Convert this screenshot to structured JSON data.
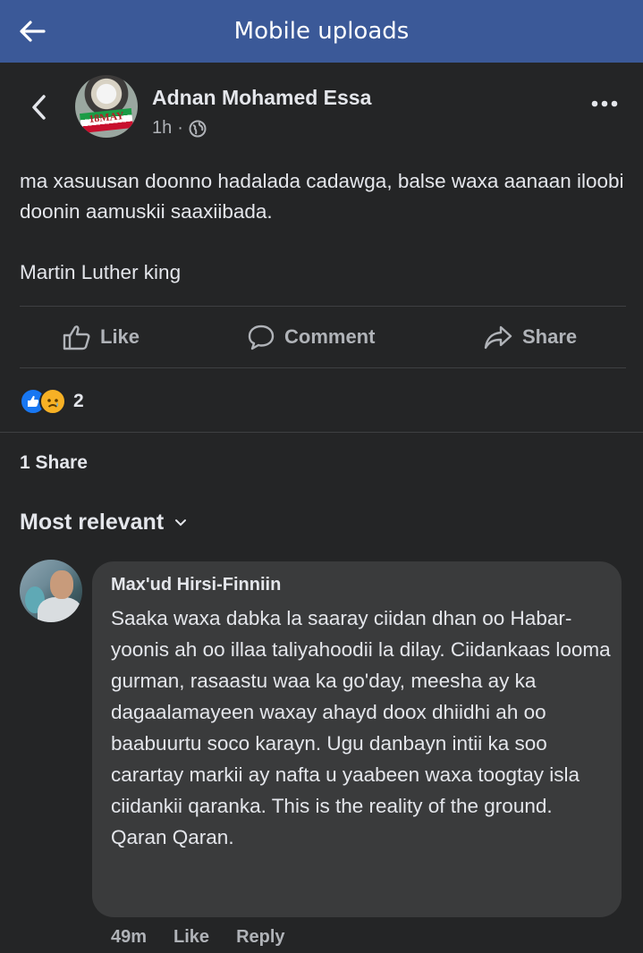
{
  "topbar": {
    "title": "Mobile uploads",
    "back_icon": "arrow-left-icon"
  },
  "post": {
    "author": "Adnan Mohamed Essa",
    "time": "1h",
    "separator": "·",
    "audience_icon": "globe-icon",
    "avatar_badge": "18MAY",
    "text_line1": "ma xasuusan doonno hadalada cadawga, balse waxa aanaan iloobi doonin aamuskii saaxiibada.",
    "text_quote": "Martin Luther king"
  },
  "actions": {
    "like": "Like",
    "comment": "Comment",
    "share": "Share"
  },
  "reactions": {
    "count": "2",
    "icons": [
      "like-reaction-icon",
      "sad-reaction-icon"
    ]
  },
  "shares": "1 Share",
  "sort": {
    "label": "Most relevant"
  },
  "comment": {
    "author": "Max'ud Hirsi-Finniin",
    "text": "Saaka waxa dabka la saaray ciidan dhan oo Habar-yoonis ah oo illaa taliyahoodii la dilay. Ciidankaas looma gurman, rasaastu waa ka go'day, meesha ay ka dagaalamayeen waxay ahayd doox dhiidhi ah oo baabuurtu soco karayn. Ugu danbayn intii ka soo carartay markii ay nafta u yaabeen waxa toogtay isla ciidankii qaranka. This is the reality of the ground. Qaran Qaran.",
    "time": "49m",
    "like": "Like",
    "reply": "Reply"
  },
  "colors": {
    "topbar": "#3b5998",
    "background": "#242526",
    "bubble": "#3a3b3c",
    "like_blue": "#1877f2"
  }
}
